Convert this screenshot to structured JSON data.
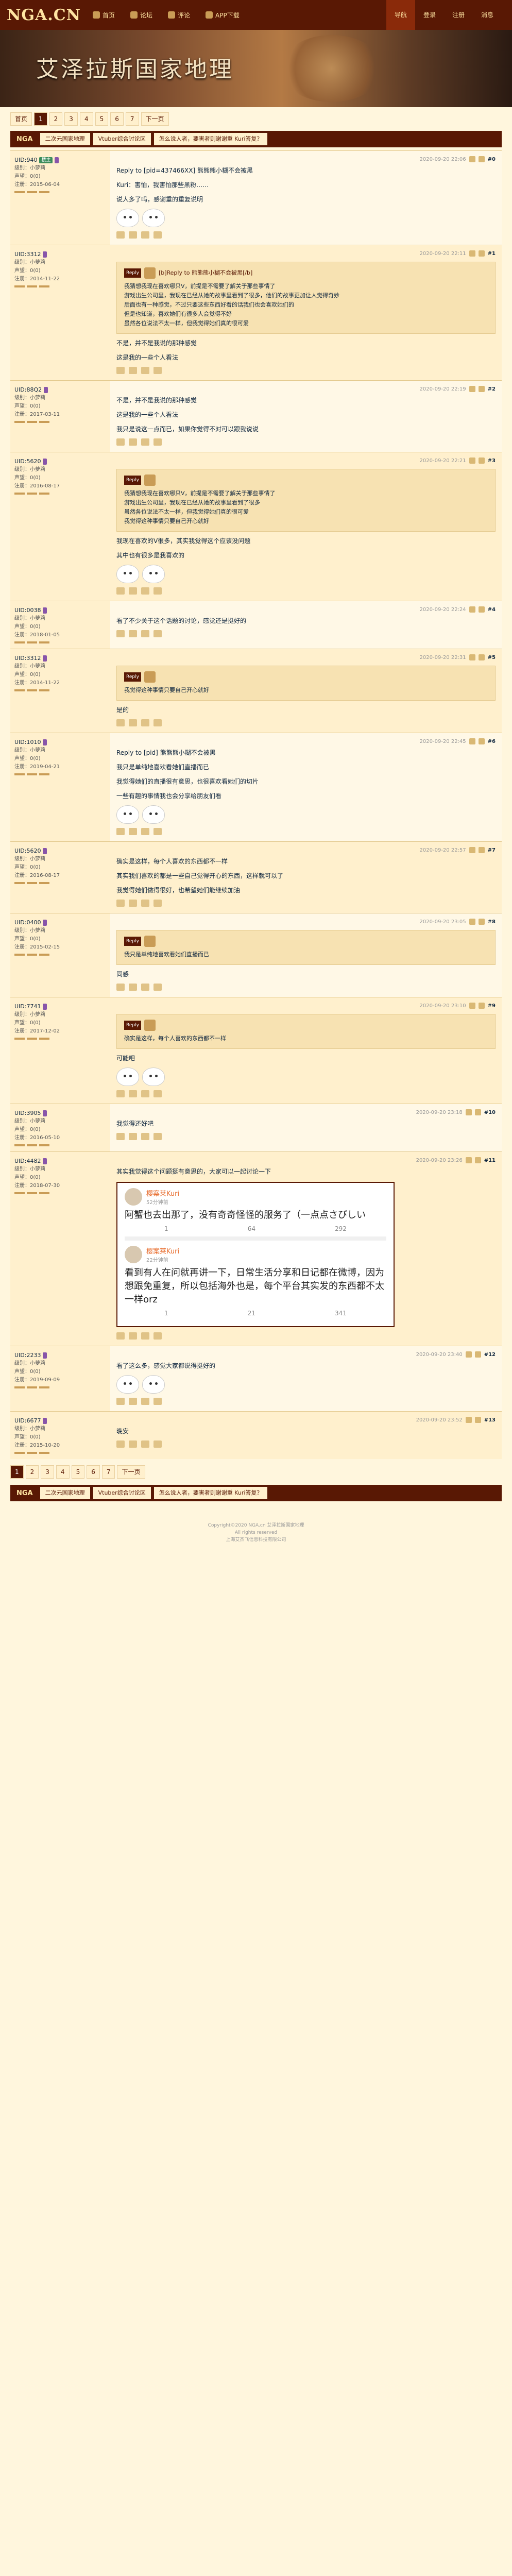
{
  "topbar": {
    "logo": "NGA.CN",
    "nav": [
      "首页",
      "论坛",
      "评论",
      "APP下载"
    ],
    "right": [
      "导航",
      "登录",
      "注册",
      "消息"
    ]
  },
  "banner": {
    "title": "艾泽拉斯国家地理"
  },
  "pager": {
    "first": "首页",
    "pages": [
      "1",
      "2",
      "3",
      "4",
      "5",
      "6",
      "7"
    ],
    "current": "1",
    "next": "下一页"
  },
  "breadcrumb": {
    "logo": "NGA",
    "items": [
      "二次元国家地理",
      "Vtuber综合讨论区",
      "怎么说人者，要害者则谢谢重 Kuri答复？"
    ]
  },
  "posts": [
    {
      "uid": "UID:940",
      "badge": "楼主",
      "floor": "#0",
      "time": "2020-09-20 22:06",
      "rank": "级别：小萝莉",
      "prestige": "声望：0(0)",
      "reg": "注册：2015-06-04",
      "body": [
        "Reply to [pid=437466XX] 熊熊熊小糊不会被黑",
        "Kuri：害怕，我害怕那些黑粉……",
        "说人多了吗，感谢重的重复说明"
      ]
    },
    {
      "uid": "UID:3312",
      "badge": "",
      "floor": "#1",
      "time": "2020-09-20 22:11",
      "rank": "级别：小萝莉",
      "prestige": "声望：0(0)",
      "reg": "注册：2014-11-22",
      "quote_head": "[b]Reply to 熊熊熊小糊不会被黑[/b]",
      "quote_body": [
        "我猜想我现在喜欢哪只V，前提是不需要了解关于那些事情了",
        "游戏出生公司里，我现在已经从她的故事里看到了很多，他们的故事更加让人觉得奇妙",
        "后面也有一种感觉，不过只要这些东西好看的话我们也会喜欢她们的",
        "但是也知道，喜欢她们有很多人会觉得不好",
        "虽然各位说法不太一样，但我觉得她们真的很可爱"
      ],
      "after": [
        "不是，并不是我说的那种感觉",
        "这是我的一些个人看法"
      ]
    },
    {
      "uid": "UID:88Q2",
      "badge": "",
      "floor": "#2",
      "time": "2020-09-20 22:19",
      "rank": "级别：小萝莉",
      "prestige": "声望：0(0)",
      "reg": "注册：2017-03-11",
      "body": [
        "不是，并不是我说的那种感觉",
        "这是我的一些个人看法"
      ],
      "after": [
        "我只是说这一点而已，如果你觉得不对可以跟我说说"
      ]
    },
    {
      "uid": "UID:5620",
      "badge": "",
      "floor": "#3",
      "time": "2020-09-20 22:21",
      "rank": "级别：小萝莉",
      "prestige": "声望：0(0)",
      "reg": "注册：2016-08-17",
      "quote_body": [
        "我猜想我现在喜欢哪只V，前提是不需要了解关于那些事情了",
        "游戏出生公司里，我现在已经从她的故事里看到了很多",
        "虽然各位说法不太一样，但我觉得她们真的很可爱",
        "我觉得这种事情只要自己开心就好"
      ],
      "after": [
        "我现在喜欢的V很多，其实我觉得这个应该没问题",
        "其中也有很多是我喜欢的"
      ]
    },
    {
      "uid": "UID:0038",
      "badge": "",
      "floor": "#4",
      "time": "2020-09-20 22:24",
      "rank": "级别：小萝莉",
      "prestige": "声望：0(0)",
      "reg": "注册：2018-01-05",
      "body": [
        "看了不少关于这个话题的讨论，感觉还是挺好的"
      ]
    },
    {
      "uid": "UID:3312",
      "badge": "",
      "floor": "#5",
      "time": "2020-09-20 22:31",
      "rank": "级别：小萝莉",
      "prestige": "声望：0(0)",
      "reg": "注册：2014-11-22",
      "quote_body": [
        "我觉得这种事情只要自己开心就好"
      ],
      "after": [
        "是的"
      ]
    },
    {
      "uid": "UID:1010",
      "badge": "",
      "floor": "#6",
      "time": "2020-09-20 22:45",
      "rank": "级别：小萝莉",
      "prestige": "声望：0(0)",
      "reg": "注册：2019-04-21",
      "body": [
        "Reply to [pid] 熊熊熊小糊不会被黑",
        "我只是单纯地喜欢看她们直播而已",
        "我觉得她们的直播很有意思，也很喜欢看她们的切片",
        "一些有趣的事情我也会分享给朋友们看"
      ]
    },
    {
      "uid": "UID:5620",
      "badge": "",
      "floor": "#7",
      "time": "2020-09-20 22:57",
      "rank": "级别：小萝莉",
      "prestige": "声望：0(0)",
      "reg": "注册：2016-08-17",
      "body": [
        "确实是这样，每个人喜欢的东西都不一样",
        "其实我们喜欢的都是一些自己觉得开心的东西，这样就可以了",
        "我觉得她们做得很好，也希望她们能继续加油"
      ]
    },
    {
      "uid": "UID:0400",
      "badge": "",
      "floor": "#8",
      "time": "2020-09-20 23:05",
      "rank": "级别：小萝莉",
      "prestige": "声望：0(0)",
      "reg": "注册：2015-02-15",
      "quote_body": [
        "我只是单纯地喜欢看她们直播而已"
      ],
      "after": [
        "同感"
      ]
    },
    {
      "uid": "UID:7741",
      "badge": "",
      "floor": "#9",
      "time": "2020-09-20 23:10",
      "rank": "级别：小萝莉",
      "prestige": "声望：0(0)",
      "reg": "注册：2017-12-02",
      "quote_body": [
        "确实是这样，每个人喜欢的东西都不一样"
      ],
      "after": [
        "可能吧"
      ]
    },
    {
      "uid": "UID:3905",
      "badge": "",
      "floor": "#10",
      "time": "2020-09-20 23:18",
      "rank": "级别：小萝莉",
      "prestige": "声望：0(0)",
      "reg": "注册：2016-05-10",
      "body": [
        "我觉得还好吧"
      ]
    },
    {
      "uid": "UID:4482",
      "badge": "",
      "floor": "#11",
      "time": "2020-09-20 23:26",
      "rank": "级别：小萝莉",
      "prestige": "声望：0(0)",
      "reg": "注册：2018-07-30",
      "body": [
        "其实我觉得这个问题挺有意思的，大家可以一起讨论一下"
      ]
    },
    {
      "uid": "UID:2233",
      "badge": "",
      "floor": "#12",
      "time": "2020-09-20 23:40",
      "rank": "级别：小萝莉",
      "prestige": "声望：0(0)",
      "reg": "注册：2019-09-09",
      "body": [
        "看了这么多，感觉大家都说得挺好的"
      ]
    },
    {
      "uid": "UID:6677",
      "badge": "",
      "floor": "#13",
      "time": "2020-09-20 23:52",
      "rank": "级别：小萝莉",
      "prestige": "声望：0(0)",
      "reg": "注册：2015-10-20",
      "body": [
        "晚安"
      ]
    }
  ],
  "weibo": {
    "posts": [
      {
        "name": "樱案莱Kuri",
        "time": "52分钟前",
        "text": "阿蟹也去出那了，没有奇奇怪怪的服务了（一点点さびしい",
        "stats": [
          "1",
          "64",
          "292"
        ]
      },
      {
        "name": "樱案莱Kuri",
        "time": "22分钟前",
        "text": "看到有人在问就再讲一下，日常生活分享和日记都在微博，因为想跟免重复，所以包括海外也是，每个平台其实发的东西都不太一样orz",
        "stats": [
          "1",
          "21",
          "341"
        ]
      }
    ]
  },
  "bottom_pager": {
    "pages": [
      "1",
      "2",
      "3",
      "4",
      "5",
      "6",
      "7"
    ],
    "current": "1",
    "next": "下一页"
  },
  "bottom_crumb": {
    "logo": "NGA",
    "items": [
      "二次元国家地理",
      "Vtuber综合讨论区",
      "怎么说人者，要害者则谢谢重 Kuri答复？"
    ]
  },
  "footer": {
    "lines": [
      "Copyright©2020 NGA.cn 艾泽拉斯国家地理",
      "All rights reserved",
      "上海艾杰飞信息科技有限公司"
    ]
  }
}
